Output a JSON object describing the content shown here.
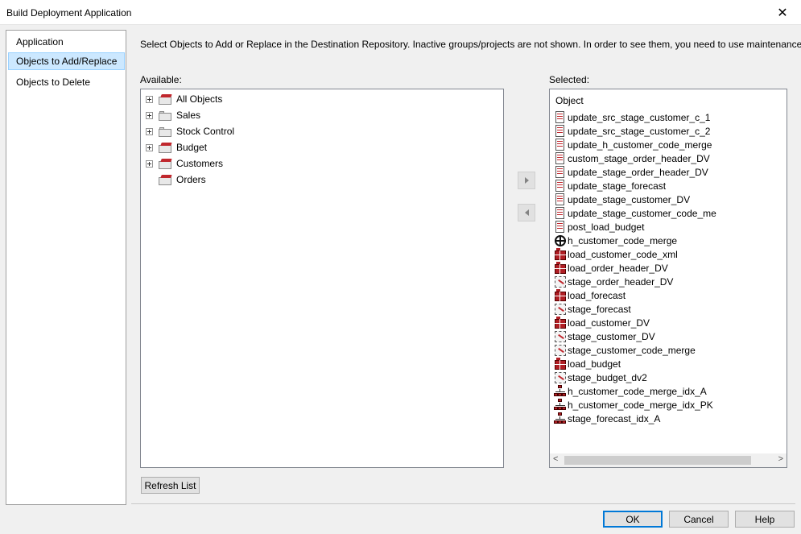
{
  "window": {
    "title": "Build Deployment Application"
  },
  "nav": {
    "items": [
      {
        "label": "Application",
        "selected": false
      },
      {
        "label": "Objects to Add/Replace",
        "selected": true
      },
      {
        "label": "Objects to Delete",
        "selected": false
      }
    ]
  },
  "instruction": "Select Objects to Add or Replace in the Destination Repository. Inactive groups/projects are not shown. In order to see them, you need to use maintenance screen.",
  "available": {
    "label": "Available:",
    "items": [
      {
        "label": "All Objects",
        "expandable": true,
        "icon": "red-folder-icon"
      },
      {
        "label": "Sales",
        "expandable": true,
        "icon": "folder-icon"
      },
      {
        "label": "Stock Control",
        "expandable": true,
        "icon": "folder-icon"
      },
      {
        "label": "Budget",
        "expandable": true,
        "icon": "red-folder-icon"
      },
      {
        "label": "Customers",
        "expandable": true,
        "icon": "red-folder-icon"
      },
      {
        "label": "Orders",
        "expandable": false,
        "icon": "red-folder-icon"
      }
    ]
  },
  "selected": {
    "label": "Selected:",
    "column_header": "Object",
    "items": [
      {
        "label": "update_src_stage_customer_c_1",
        "icon": "script-icon"
      },
      {
        "label": "update_src_stage_customer_c_2",
        "icon": "script-icon"
      },
      {
        "label": "update_h_customer_code_merge",
        "icon": "script-icon"
      },
      {
        "label": "custom_stage_order_header_DV",
        "icon": "script-icon"
      },
      {
        "label": "update_stage_order_header_DV",
        "icon": "script-icon"
      },
      {
        "label": "update_stage_forecast",
        "icon": "script-icon"
      },
      {
        "label": "update_stage_customer_DV",
        "icon": "script-icon"
      },
      {
        "label": "update_stage_customer_code_me",
        "icon": "script-icon"
      },
      {
        "label": "post_load_budget",
        "icon": "script-icon"
      },
      {
        "label": "h_customer_code_merge",
        "icon": "hub-icon"
      },
      {
        "label": "load_customer_code_xml",
        "icon": "load-table-icon"
      },
      {
        "label": "load_order_header_DV",
        "icon": "load-table-icon"
      },
      {
        "label": "stage_order_header_DV",
        "icon": "stage-table-icon"
      },
      {
        "label": "load_forecast",
        "icon": "load-table-icon"
      },
      {
        "label": "stage_forecast",
        "icon": "stage-table-icon"
      },
      {
        "label": "load_customer_DV",
        "icon": "load-table-icon"
      },
      {
        "label": "stage_customer_DV",
        "icon": "stage-table-icon"
      },
      {
        "label": "stage_customer_code_merge",
        "icon": "stage-table-icon"
      },
      {
        "label": "load_budget",
        "icon": "load-table-icon"
      },
      {
        "label": "stage_budget_dv2",
        "icon": "stage-table-icon"
      },
      {
        "label": "h_customer_code_merge_idx_A",
        "icon": "index-icon"
      },
      {
        "label": "h_customer_code_merge_idx_PK",
        "icon": "index-icon"
      },
      {
        "label": "stage_forecast_idx_A",
        "icon": "index-icon"
      }
    ]
  },
  "buttons": {
    "refresh": "Refresh List",
    "ok": "OK",
    "cancel": "Cancel",
    "help": "Help"
  },
  "colors": {
    "selection": "#cce8ff",
    "accent": "#0078d7",
    "icon_red": "#c0272d"
  }
}
